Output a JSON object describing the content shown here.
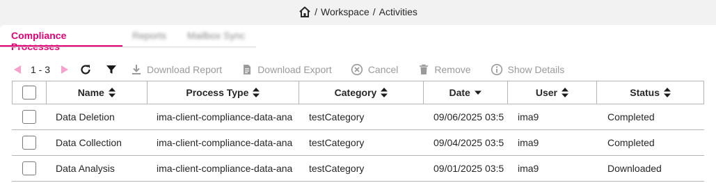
{
  "breadcrumb": {
    "icon": "home-icon",
    "separator": "/",
    "items": [
      "Workspace",
      "Activities"
    ]
  },
  "tabs": [
    {
      "label": "Compliance Processes",
      "active": true
    },
    {
      "label": "Reports",
      "active": false
    },
    {
      "label": "Mailbox Sync",
      "active": false
    }
  ],
  "toolbar": {
    "page_range": "1 - 3",
    "download_report": "Download Report",
    "download_export": "Download Export",
    "cancel": "Cancel",
    "remove": "Remove",
    "show_details": "Show Details"
  },
  "table": {
    "columns": [
      "Name",
      "Process Type",
      "Category",
      "Date",
      "User",
      "Status"
    ],
    "rows": [
      {
        "name": "Data Deletion",
        "process_type": "ima-client-compliance-data-ana",
        "category": "testCategory",
        "date": "09/06/2025 03:5",
        "user": "ima9",
        "status": "Completed"
      },
      {
        "name": "Data Collection",
        "process_type": "ima-client-compliance-data-ana",
        "category": "testCategory",
        "date": "09/04/2025 03:5",
        "user": "ima9",
        "status": "Completed"
      },
      {
        "name": "Data Analysis",
        "process_type": "ima-client-compliance-data-ana",
        "category": "testCategory",
        "date": "09/01/2025 03:5",
        "user": "ima9",
        "status": "Downloaded"
      }
    ]
  },
  "colors": {
    "accent": "#e20074",
    "accent_light": "#f7a1cd",
    "disabled": "#9a9a9a",
    "border": "#b5b5b5"
  }
}
